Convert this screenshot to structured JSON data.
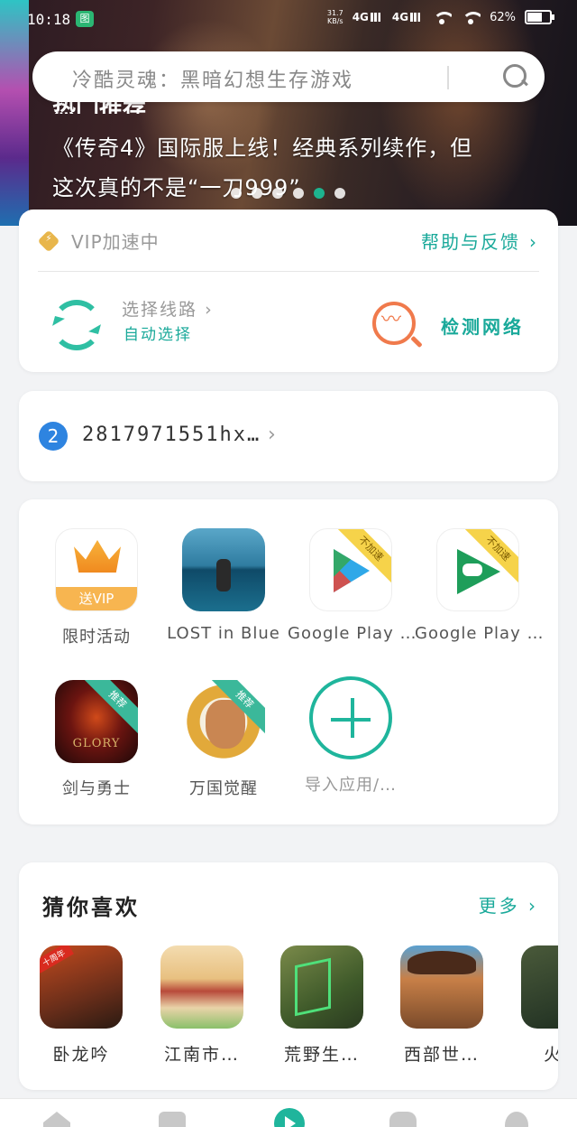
{
  "status_bar": {
    "time": "10:18",
    "app_icon_text": "图",
    "net_speed_value": "31.7",
    "net_speed_unit": "KB/s",
    "signal_1": "4G",
    "signal_2": "4G",
    "battery": "62%"
  },
  "search": {
    "placeholder": "冷酷灵魂：黑暗幻想生存游戏"
  },
  "hero": {
    "heading": "热门推荐",
    "description": "《传奇4》国际服上线！经典系列续作，但\n这次真的不是“一刀999”",
    "slide_count": 6,
    "active_slide": 5,
    "active_color": "#1db38f"
  },
  "vip_card": {
    "status_label": "VIP加速中",
    "help_link": "帮助与反馈",
    "route_title": "选择线路",
    "route_value": "自动选择",
    "detect_label": "检测网络",
    "accent_color": "#1aa99a"
  },
  "account": {
    "badge": "2",
    "name": "2817971551hx…",
    "chevron": "›"
  },
  "apps": [
    {
      "label": "限时活动",
      "icon": "vip-crown-icon",
      "tag": "送VIP"
    },
    {
      "label": "LOST in Blue",
      "icon": "lost-in-blue-icon"
    },
    {
      "label": "Google Play …",
      "icon": "google-play-icon",
      "ribbon": "不加速"
    },
    {
      "label": "Google Play …",
      "icon": "google-play-games-icon",
      "ribbon": "不加速"
    },
    {
      "label": "剑与勇士",
      "icon": "glory-game-icon",
      "ribbon": "推荐",
      "logo": "GLORY"
    },
    {
      "label": "万国觉醒",
      "icon": "rise-of-kingdoms-icon",
      "ribbon": "推荐"
    },
    {
      "label": "导入应用/…",
      "icon": "add-circle-icon"
    }
  ],
  "guess": {
    "title": "猜你喜欢",
    "more": "更多",
    "games": [
      {
        "label": "卧龙吟",
        "icon": "wolongyin-icon"
      },
      {
        "label": "江南市…",
        "icon": "jiangnan-icon"
      },
      {
        "label": "荒野生…",
        "icon": "wilderness-icon"
      },
      {
        "label": "西部世…",
        "icon": "westworld-icon"
      },
      {
        "label": "火力",
        "icon": "firepower-icon"
      }
    ]
  },
  "bottom_nav": [
    "home-icon",
    "box-icon",
    "play-icon",
    "gamepad-icon",
    "profile-icon"
  ]
}
